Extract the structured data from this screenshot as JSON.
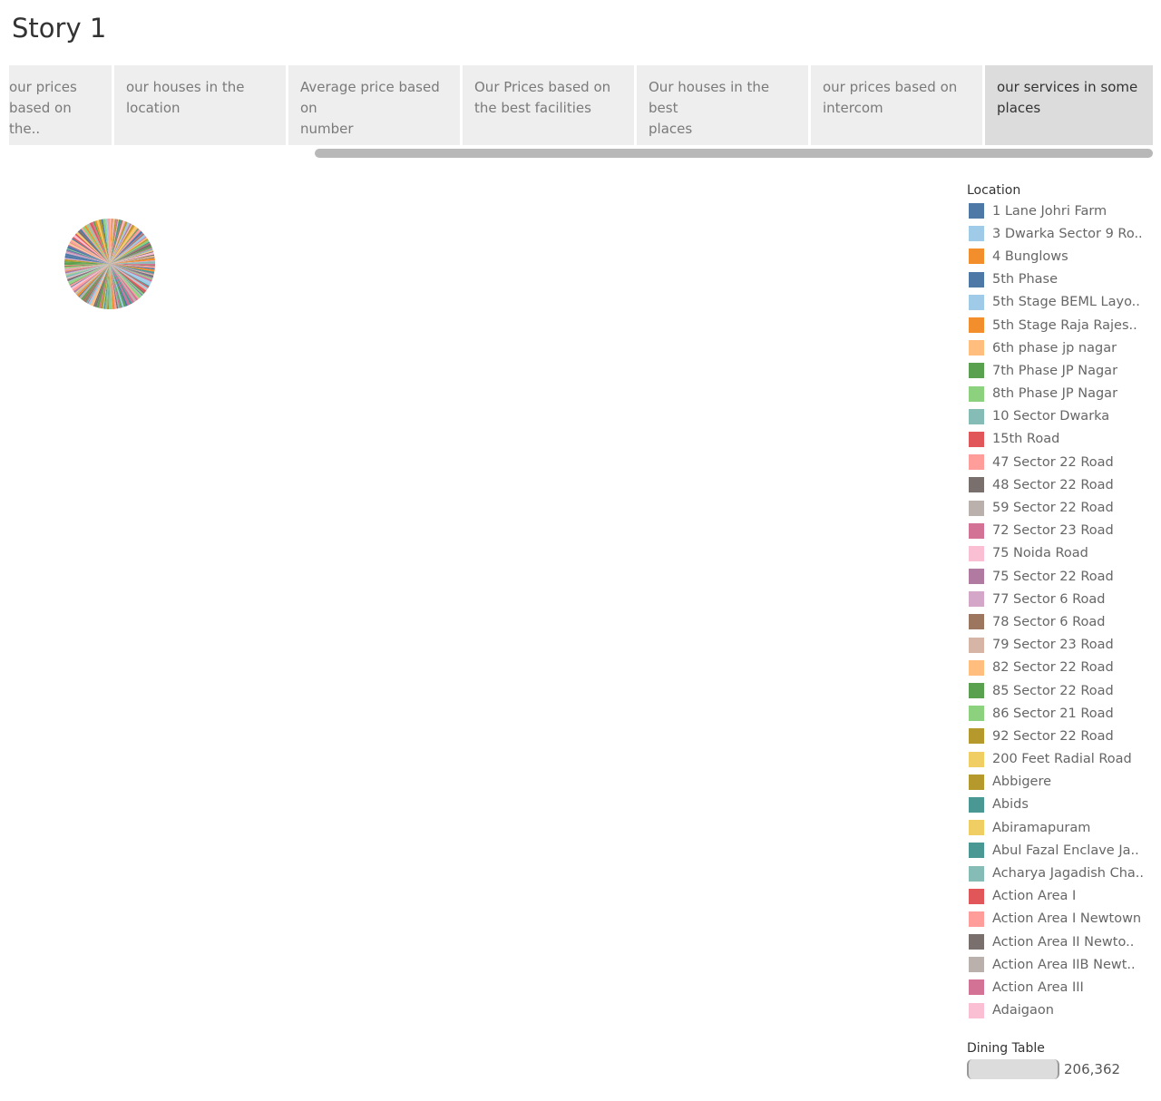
{
  "story": {
    "title": "Story 1"
  },
  "tabs": [
    {
      "label_line1": "our  prices",
      "label_line2": "based on the..",
      "active": false
    },
    {
      "label_line1": "our houses in the",
      "label_line2": "location",
      "active": false
    },
    {
      "label_line1": "Average price based on",
      "label_line2": "number",
      "active": false
    },
    {
      "label_line1": "Our Prices based on",
      "label_line2": "the best facilities",
      "active": false
    },
    {
      "label_line1": "Our houses in the best",
      "label_line2": "places",
      "active": false
    },
    {
      "label_line1": "our  prices  based on",
      "label_line2": "intercom",
      "active": false
    },
    {
      "label_line1": "our services in some",
      "label_line2": "places",
      "active": true
    }
  ],
  "legend": {
    "title": "Location",
    "items": [
      {
        "label": "1 Lane Johri Farm",
        "color": "#4e79a7"
      },
      {
        "label": "3 Dwarka Sector 9 Ro..",
        "color": "#a0cbe8"
      },
      {
        "label": "4 Bunglows",
        "color": "#f28e2b"
      },
      {
        "label": "5th Phase",
        "color": "#4e79a7"
      },
      {
        "label": "5th Stage BEML Layo..",
        "color": "#a0cbe8"
      },
      {
        "label": "5th Stage Raja Rajes..",
        "color": "#f28e2b"
      },
      {
        "label": "6th phase jp nagar",
        "color": "#ffbe7d"
      },
      {
        "label": "7th Phase JP Nagar",
        "color": "#59a14f"
      },
      {
        "label": "8th Phase JP Nagar",
        "color": "#8cd17d"
      },
      {
        "label": "10 Sector Dwarka",
        "color": "#86bcb6"
      },
      {
        "label": "15th Road",
        "color": "#e15759"
      },
      {
        "label": "47 Sector 22 Road",
        "color": "#ff9d9a"
      },
      {
        "label": "48 Sector 22 Road",
        "color": "#79706e"
      },
      {
        "label": "59 Sector 22 Road",
        "color": "#bab0ac"
      },
      {
        "label": "72 Sector 23 Road",
        "color": "#d37295"
      },
      {
        "label": "75 Noida Road",
        "color": "#fabfd2"
      },
      {
        "label": "75 Sector 22 Road",
        "color": "#b07aa1"
      },
      {
        "label": "77 Sector 6 Road",
        "color": "#d4a6c8"
      },
      {
        "label": "78 Sector 6 Road",
        "color": "#9d7660"
      },
      {
        "label": "79 Sector 23 Road",
        "color": "#d7b5a6"
      },
      {
        "label": "82 Sector 22 Road",
        "color": "#ffbe7d"
      },
      {
        "label": "85 Sector 22 Road",
        "color": "#59a14f"
      },
      {
        "label": "86 Sector 21 Road",
        "color": "#8cd17d"
      },
      {
        "label": "92 Sector 22 Road",
        "color": "#b6992d"
      },
      {
        "label": "200 Feet Radial Road",
        "color": "#f1ce63"
      },
      {
        "label": "Abbigere",
        "color": "#b6992d"
      },
      {
        "label": "Abids",
        "color": "#499894"
      },
      {
        "label": "Abiramapuram",
        "color": "#f1ce63"
      },
      {
        "label": "Abul Fazal Enclave Ja..",
        "color": "#499894"
      },
      {
        "label": "Acharya Jagadish Cha..",
        "color": "#86bcb6"
      },
      {
        "label": "Action Area I",
        "color": "#e15759"
      },
      {
        "label": "Action Area I Newtown",
        "color": "#ff9d9a"
      },
      {
        "label": "Action Area II Newto..",
        "color": "#79706e"
      },
      {
        "label": "Action Area IIB Newt..",
        "color": "#bab0ac"
      },
      {
        "label": "Action Area III",
        "color": "#d37295"
      },
      {
        "label": "Adaigaon",
        "color": "#fabfd2"
      }
    ]
  },
  "size_legend": {
    "title": "Dining Table",
    "value": "206,362"
  }
}
